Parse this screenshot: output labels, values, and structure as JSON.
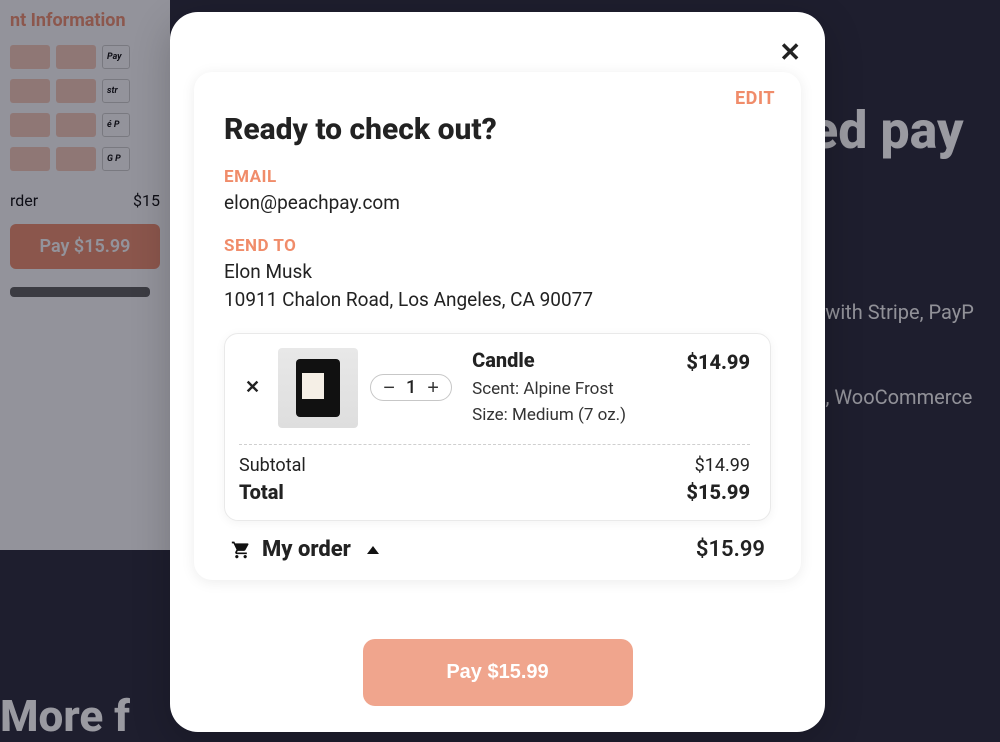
{
  "background": {
    "panel_heading": "nt Information",
    "order_label": "rder",
    "order_price": "$15",
    "pay_label": "Pay $15.99",
    "hero": "ed pay",
    "sub1": "s with Stripe, PayP",
    "sub2": "le, WooCommerce",
    "footer": "More f",
    "chip_pay": "Pay",
    "chip_str": "str",
    "chip_apple": "é P",
    "chip_g": "G P"
  },
  "modal": {
    "edit": "EDIT",
    "title": "Ready to check out?",
    "email_label": "EMAIL",
    "email_value": "elon@peachpay.com",
    "sendto_label": "SEND TO",
    "sendto_name": "Elon Musk",
    "sendto_address": "10911 Chalon Road, Los Angeles, CA 90077",
    "item": {
      "name": "Candle",
      "price": "$14.99",
      "qty": "1",
      "scent_line": "Scent: Alpine Frost",
      "size_line": "Size: Medium (7 oz.)"
    },
    "subtotal_label": "Subtotal",
    "subtotal_value": "$14.99",
    "total_label": "Total",
    "total_value": "$15.99",
    "order_toggle_label": "My order",
    "order_toggle_total": "$15.99",
    "pay_button": "Pay $15.99"
  }
}
